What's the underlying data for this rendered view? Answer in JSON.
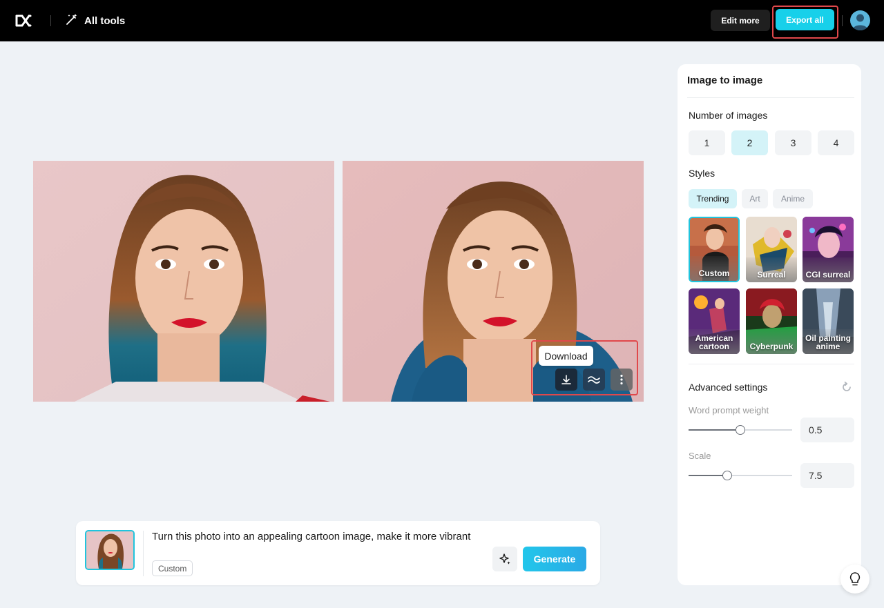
{
  "header": {
    "all_tools_label": "All tools",
    "edit_more_label": "Edit more",
    "export_all_label": "Export all",
    "logo_icon": "capcut-logo-icon",
    "all_tools_icon": "magic-wand-icon"
  },
  "canvas": {
    "tooltip": "Download",
    "actions": [
      "download-icon",
      "wave-icon",
      "more-vertical-icon"
    ]
  },
  "panel": {
    "title": "Image to image",
    "number_of_images_label": "Number of images",
    "number_options": [
      "1",
      "2",
      "3",
      "4"
    ],
    "selected_number": "2",
    "styles_label": "Styles",
    "style_tabs": [
      "Trending",
      "Art",
      "Anime"
    ],
    "active_style_tab": "Trending",
    "style_tiles": [
      {
        "label": "Custom",
        "selected": true
      },
      {
        "label": "Surreal",
        "selected": false
      },
      {
        "label": "CGI surreal",
        "selected": false
      },
      {
        "label": "American cartoon",
        "selected": false
      },
      {
        "label": "Cyberpunk",
        "selected": false
      },
      {
        "label": "Oil painting anime",
        "selected": false
      }
    ],
    "advanced_label": "Advanced settings",
    "word_prompt_weight_label": "Word prompt weight",
    "word_prompt_weight_value": "0.5",
    "word_prompt_weight_fraction": 0.5,
    "scale_label": "Scale",
    "scale_value": "7.5",
    "scale_fraction": 0.37
  },
  "prompt": {
    "text": "Turn this photo into an appealing cartoon image, make it more vibrant",
    "chip": "Custom",
    "generate_label": "Generate"
  },
  "colors": {
    "accent": "#17d0ea",
    "highlight": "#e0484b"
  }
}
